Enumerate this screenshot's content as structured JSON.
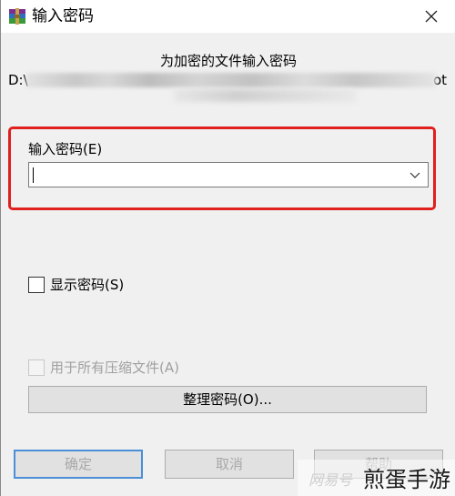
{
  "window": {
    "title": "输入密码",
    "icon": "winrar-icon",
    "close_icon": "close-icon"
  },
  "dialog": {
    "heading": "为加密的文件输入密码",
    "path_start": "D:\\",
    "path_end": "ot",
    "password_label": "输入密码(E)",
    "password_value": "",
    "show_password_label": "显示密码(S)",
    "show_password_checked": false,
    "apply_all_label": "用于所有压缩文件(A)",
    "apply_all_enabled": false,
    "organize_button": "整理密码(O)..."
  },
  "buttons": {
    "ok": "确定",
    "cancel": "取消",
    "help": "帮助"
  },
  "watermark": {
    "small": "网易号",
    "big": "煎蛋手游"
  },
  "colors": {
    "highlight": "#e0201e",
    "default_button_border": "#4a8fd8",
    "dialog_bg": "#f0f0f0"
  }
}
